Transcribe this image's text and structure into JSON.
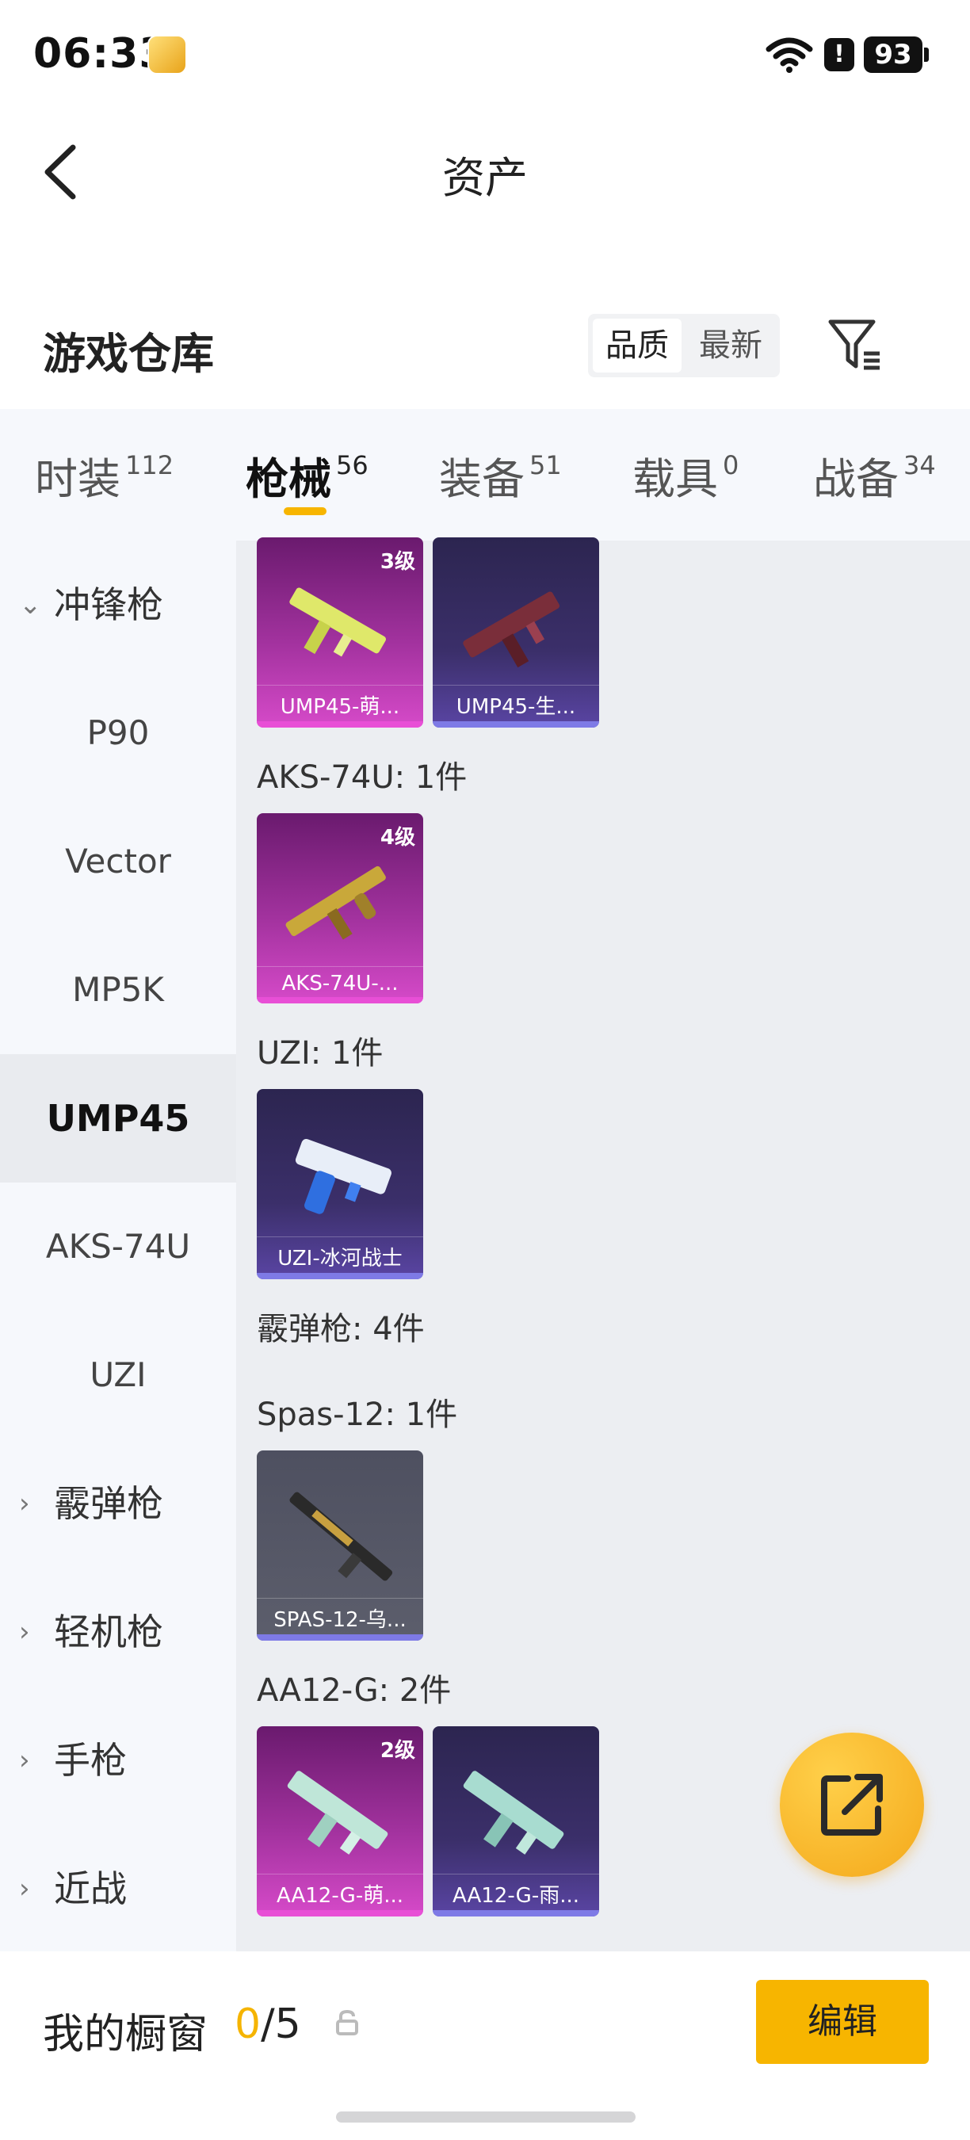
{
  "status": {
    "time": "06:33",
    "battery": "93",
    "alert": "!"
  },
  "header": {
    "title": "资产"
  },
  "warehouse": {
    "title": "游戏仓库",
    "sort": [
      "品质",
      "最新"
    ]
  },
  "tabs": [
    {
      "label": "时装",
      "count": "112"
    },
    {
      "label": "枪械",
      "count": "56"
    },
    {
      "label": "装备",
      "count": "51"
    },
    {
      "label": "载具",
      "count": "0"
    },
    {
      "label": "战备",
      "count": "34"
    }
  ],
  "sidebar": {
    "items": [
      {
        "label": "冲锋枪",
        "expanded": true
      },
      {
        "label": "P90"
      },
      {
        "label": "Vector"
      },
      {
        "label": "MP5K"
      },
      {
        "label": "UMP45"
      },
      {
        "label": "AKS-74U"
      },
      {
        "label": "UZI"
      },
      {
        "label": "霰弹枪"
      },
      {
        "label": "轻机枪"
      },
      {
        "label": "手枪"
      },
      {
        "label": "近战"
      }
    ]
  },
  "content": {
    "sections": [
      {
        "label": "AKS-74U: 1件"
      },
      {
        "label": "UZI: 1件"
      },
      {
        "label": "霰弹枪: 4件"
      },
      {
        "label": "Spas-12: 1件"
      },
      {
        "label": "AA12-G: 2件"
      }
    ],
    "cards": [
      {
        "name": "UMP45-萌...",
        "level": "3级",
        "rarity": "pink"
      },
      {
        "name": "UMP45-生...",
        "level": "",
        "rarity": "purple"
      },
      {
        "name": "AKS-74U-...",
        "level": "4级",
        "rarity": "pink"
      },
      {
        "name": "UZI-冰河战士",
        "level": "",
        "rarity": "purple"
      },
      {
        "name": "SPAS-12-乌...",
        "level": "",
        "rarity": "grey"
      },
      {
        "name": "AA12-G-萌...",
        "level": "2级",
        "rarity": "pink"
      },
      {
        "name": "AA12-G-雨...",
        "level": "",
        "rarity": "purple"
      }
    ]
  },
  "showcase": {
    "title": "我的橱窗",
    "current": "0",
    "total": "/5",
    "edit_label": "编辑"
  },
  "colors": {
    "accent": "#f7b500",
    "pink_card": "#a2329e",
    "purple_card": "#3b2f6a"
  }
}
